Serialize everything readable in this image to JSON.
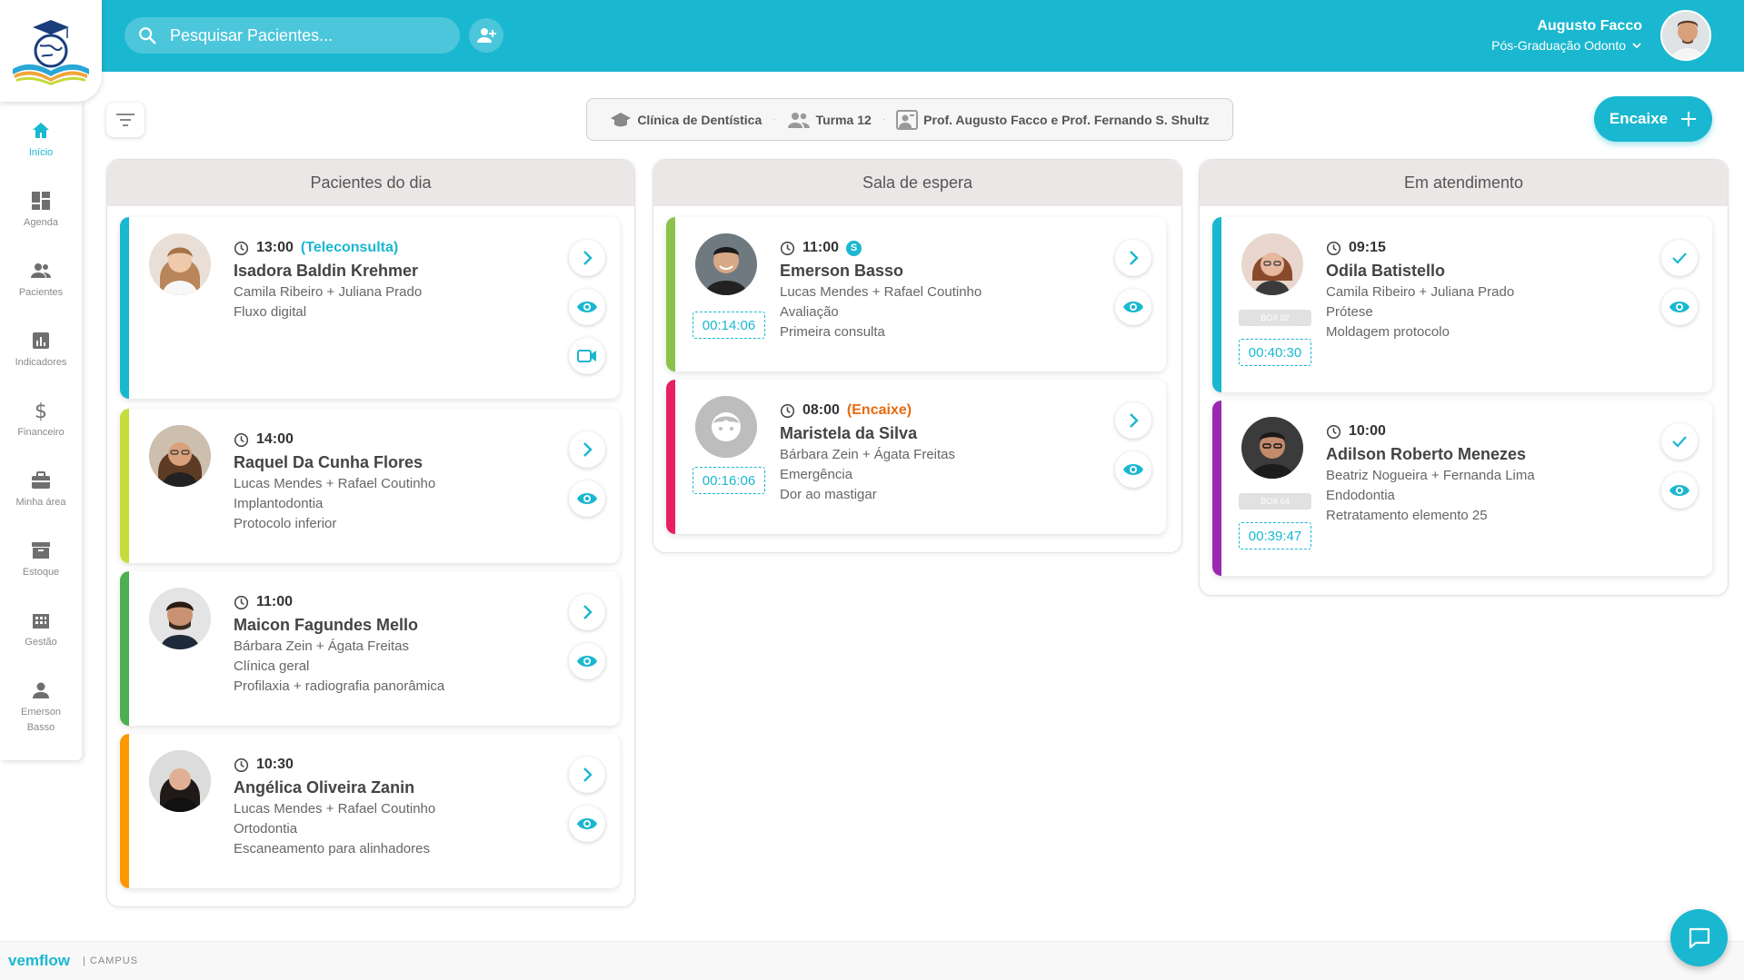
{
  "header": {
    "search_placeholder": "Pesquisar Pacientes...",
    "user_name": "Augusto Facco",
    "user_course": "Pós-Graduação Odonto"
  },
  "sidebar": {
    "items": [
      {
        "label": "Início",
        "icon": "home-icon"
      },
      {
        "label": "Agenda",
        "icon": "dashboard-icon"
      },
      {
        "label": "Pacientes",
        "icon": "people-icon"
      },
      {
        "label": "Indicadores",
        "icon": "chart-icon"
      },
      {
        "label": "Financeiro",
        "icon": "dollar-icon"
      },
      {
        "label": "Minha área",
        "icon": "briefcase-icon"
      },
      {
        "label": "Estoque",
        "icon": "archive-icon"
      },
      {
        "label": "Gestão",
        "icon": "building-icon"
      },
      {
        "label": "Emerson Basso",
        "icon": "person-icon"
      }
    ]
  },
  "context": {
    "clinic": "Clínica de Dentística",
    "class": "Turma 12",
    "professors": "Prof. Augusto Facco e Prof. Fernando S. Shultz"
  },
  "encaixe_label": "Encaixe",
  "colors": {
    "accent": "#1ab7d0",
    "blue": "#1ab7d0",
    "lime": "#c6dc3a",
    "green": "#4caf50",
    "orange": "#ff9800",
    "pink": "#e91e63",
    "purple": "#9c27b0",
    "encaixe_tag": "#e86a10"
  },
  "columns": [
    {
      "title": "Pacientes do dia",
      "cards": [
        {
          "time": "13:00",
          "tag": "(Teleconsulta)",
          "name": "Isadora Baldin Krehmer",
          "lines": [
            "Camila Ribeiro + Juliana Prado",
            "Fluxo digital"
          ]
        },
        {
          "time": "14:00",
          "tag": "",
          "name": "Raquel Da Cunha Flores",
          "lines": [
            "Lucas Mendes + Rafael Coutinho",
            "Implantodontia",
            "Protocolo inferior"
          ]
        },
        {
          "time": "11:00",
          "tag": "",
          "name": "Maicon Fagundes Mello",
          "lines": [
            "Bárbara Zein + Ágata Freitas",
            "Clínica geral",
            "Profilaxia + radiografia panorâmica"
          ]
        },
        {
          "time": "10:30",
          "tag": "",
          "name": "Angélica Oliveira Zanin",
          "lines": [
            "Lucas Mendes + Rafael Coutinho",
            "Ortodontia",
            "Escaneamento para alinhadores"
          ]
        }
      ]
    },
    {
      "title": "Sala de espera",
      "cards": [
        {
          "time": "11:00",
          "tag": "",
          "badge": "S",
          "name": "Emerson Basso",
          "timer": "00:14:06",
          "lines": [
            "Lucas Mendes + Rafael Coutinho",
            "Avaliação",
            "Primeira consulta"
          ]
        },
        {
          "time": "08:00",
          "tag": "(Encaixe)",
          "name": "Maristela da Silva",
          "timer": "00:16:06",
          "lines": [
            "Bárbara Zein + Ágata Freitas",
            "Emergência",
            "Dor ao mastigar"
          ]
        }
      ]
    },
    {
      "title": "Em atendimento",
      "cards": [
        {
          "time": "09:15",
          "name": "Odila Batistello",
          "box": "BOX 02",
          "timer": "00:40:30",
          "lines": [
            "Camila Ribeiro + Juliana Prado",
            "Prótese",
            "Moldagem protocolo"
          ]
        },
        {
          "time": "10:00",
          "name": "Adilson Roberto Menezes",
          "box": "BOX 04",
          "timer": "00:39:47",
          "lines": [
            "Beatriz Nogueira + Fernanda Lima",
            "Endodontia",
            "Retratamento elemento 25"
          ]
        }
      ]
    }
  ],
  "footer": {
    "brand": "vemflow",
    "campus": "| CAMPUS"
  }
}
